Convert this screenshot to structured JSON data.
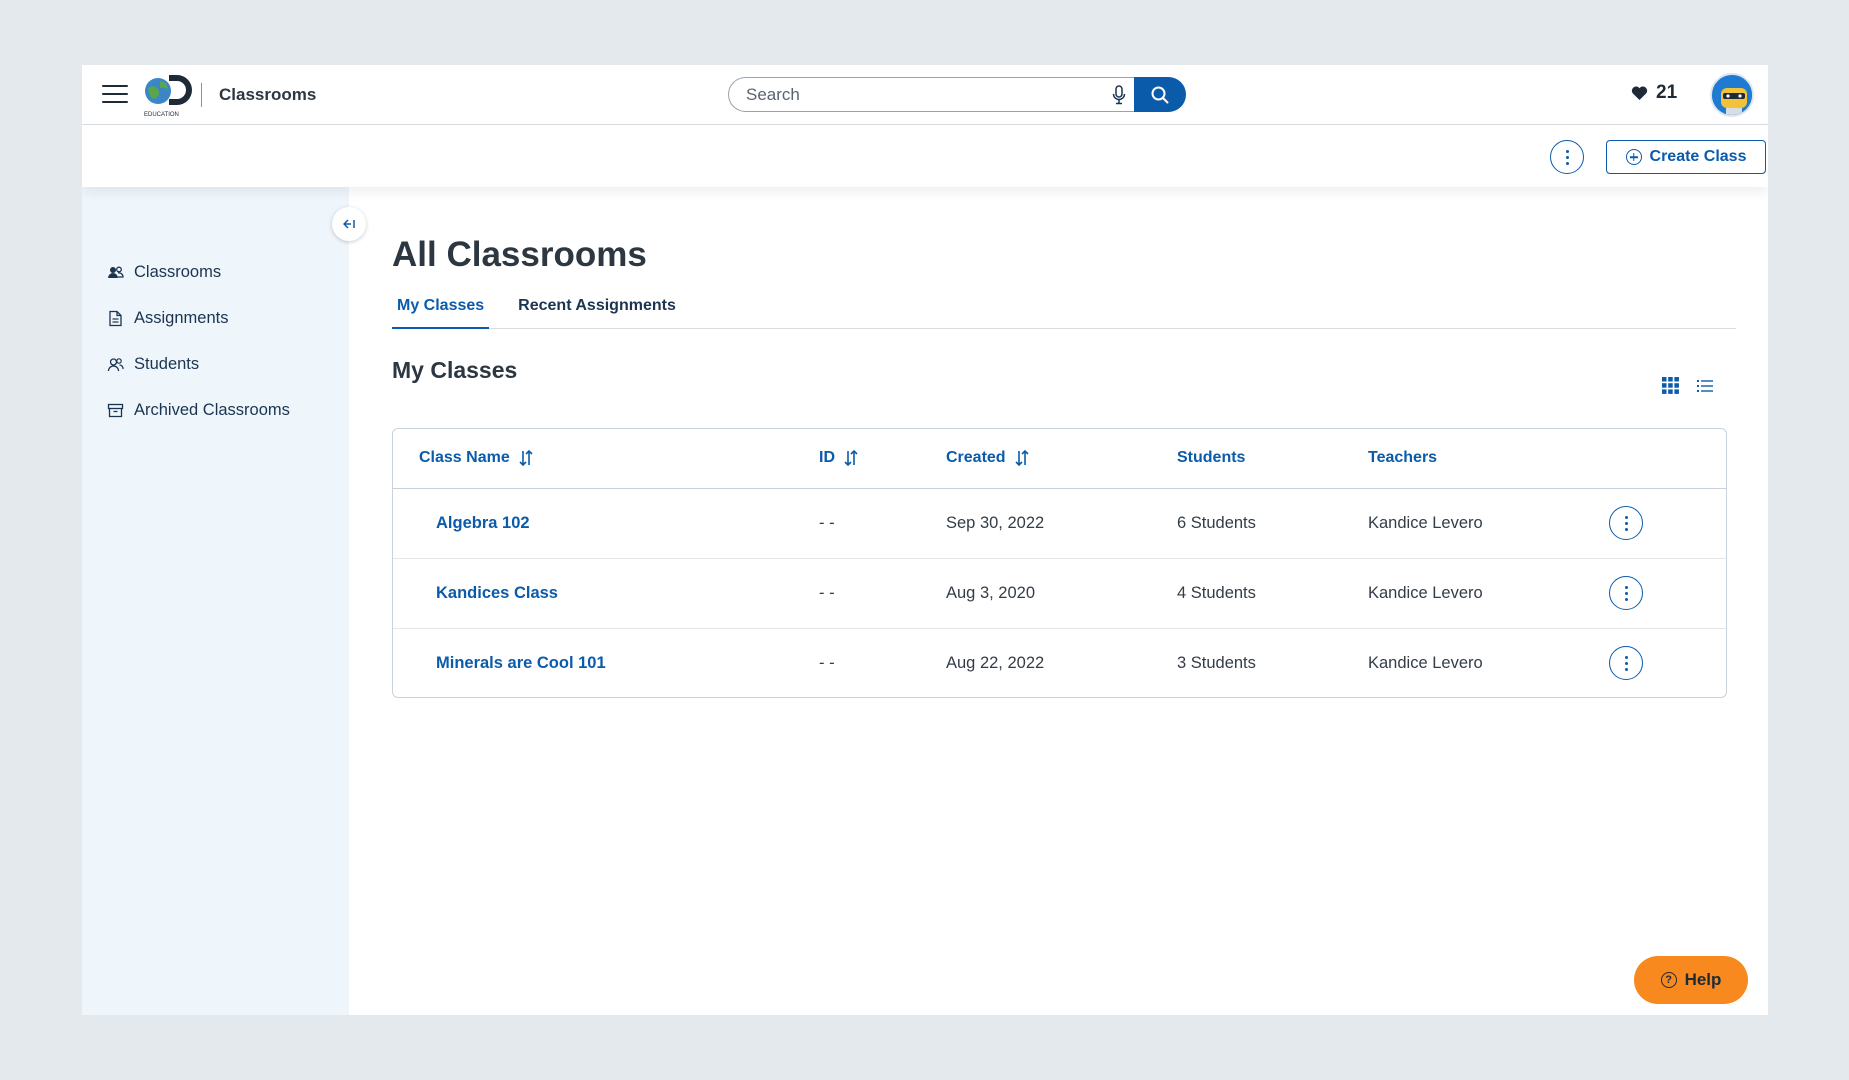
{
  "header": {
    "menu_icon": "hamburger-icon",
    "logo_text": "EDUCATION",
    "app_title": "Classrooms",
    "search_placeholder": "Search",
    "likes_count": "21",
    "brand_color": "#0b5bab"
  },
  "subheader": {
    "create_label": "Create Class"
  },
  "sidebar": {
    "items": [
      {
        "label": "Classrooms",
        "icon": "users-icon"
      },
      {
        "label": "Assignments",
        "icon": "document-icon"
      },
      {
        "label": "Students",
        "icon": "student-icon"
      },
      {
        "label": "Archived Classrooms",
        "icon": "archive-icon"
      }
    ]
  },
  "main": {
    "title": "All Classrooms",
    "tabs": [
      {
        "label": "My Classes",
        "active": true
      },
      {
        "label": "Recent Assignments",
        "active": false
      }
    ],
    "section_title": "My Classes",
    "table": {
      "headers": [
        "Class Name",
        "ID",
        "Created",
        "Students",
        "Teachers"
      ],
      "rows": [
        {
          "name": "Algebra 102",
          "id": "- -",
          "created": "Sep 30, 2022",
          "students": "6 Students",
          "teacher": "Kandice Levero"
        },
        {
          "name": "Kandices Class",
          "id": "- -",
          "created": "Aug 3, 2020",
          "students": "4 Students",
          "teacher": "Kandice Levero"
        },
        {
          "name": "Minerals are Cool 101",
          "id": "- -",
          "created": "Aug 22, 2022",
          "students": "3 Students",
          "teacher": "Kandice Levero"
        }
      ]
    }
  },
  "help": {
    "label": "Help",
    "color": "#f7891f"
  }
}
